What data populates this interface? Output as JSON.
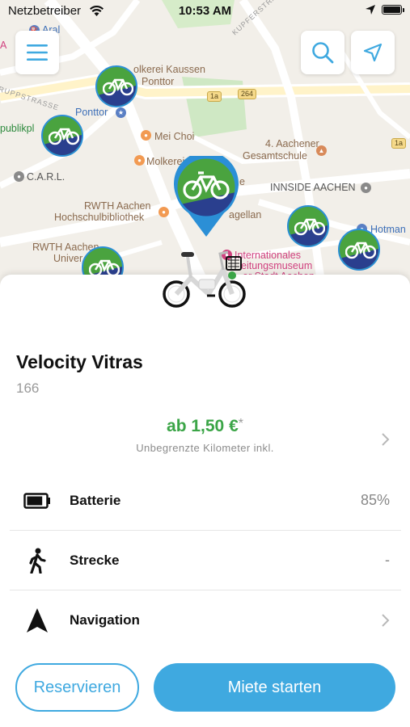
{
  "status_bar": {
    "carrier": "Netzbetreiber",
    "time": "10:53 AM"
  },
  "map": {
    "pois": [
      {
        "text": "Aral",
        "style": "blue"
      },
      {
        "text": "A",
        "style": "pink"
      },
      {
        "text": "olkerei Kaussen",
        "style": "brown"
      },
      {
        "text": "Ponttor",
        "style": "brown"
      },
      {
        "text": "Ponttor",
        "style": "blue"
      },
      {
        "text": "publikpl",
        "style": "green"
      },
      {
        "text": "Mei Choi",
        "style": "brown"
      },
      {
        "text": "Molkerei",
        "style": "brown"
      },
      {
        "text": "4. Aachener",
        "style": "brown"
      },
      {
        "text": "Gesamtschule",
        "style": "brown"
      },
      {
        "text": "C.A.R.L.",
        "style": "dark"
      },
      {
        "text": "INNSIDE AACHEN",
        "style": "dark"
      },
      {
        "text": "RWTH Aachen",
        "style": "brown"
      },
      {
        "text": "Hochschulbibliothek",
        "style": "brown"
      },
      {
        "text": "agellan",
        "style": "brown"
      },
      {
        "text": "e",
        "style": "brown"
      },
      {
        "text": "Hotman",
        "style": "blue"
      },
      {
        "text": "RWTH Aachen",
        "style": "brown"
      },
      {
        "text": "Univer",
        "style": "brown"
      },
      {
        "text": "Internationales",
        "style": "pink"
      },
      {
        "text": "eitungsmuseum",
        "style": "pink"
      },
      {
        "text": "er Stadt Aachen",
        "style": "pink"
      }
    ],
    "streets": [
      "KUPFERSTRASSE",
      "RUPPSTRASSE"
    ],
    "shields": [
      "1a",
      "264",
      "1a"
    ],
    "colors": {
      "marker_green": "#4aa33f",
      "marker_band": "#2a3f8e",
      "pin_blue": "#2b8fd6"
    }
  },
  "bike": {
    "name": "Velocity Vitras",
    "id": "166"
  },
  "pricing": {
    "price": "ab 1,50 €",
    "asterisk": "*",
    "subtitle": "Unbegrenzte Kilometer inkl."
  },
  "rows": [
    {
      "icon": "battery-icon",
      "label": "Batterie",
      "value": "85%",
      "level": 0.85
    },
    {
      "icon": "walking-person-icon",
      "label": "Strecke",
      "value": "-"
    },
    {
      "icon": "navigation-arrow-icon",
      "label": "Navigation",
      "value": ""
    }
  ],
  "actions": {
    "reserve": "Reservieren",
    "start": "Miete starten"
  },
  "colors": {
    "accent": "#3fa9e0",
    "price_green": "#3ba547"
  }
}
